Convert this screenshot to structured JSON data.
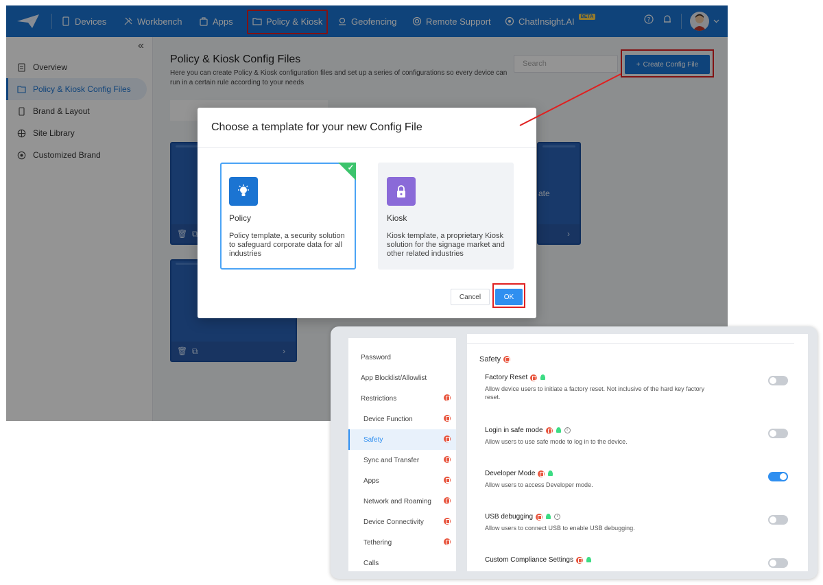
{
  "nav": {
    "items": [
      {
        "label": "Devices"
      },
      {
        "label": "Workbench"
      },
      {
        "label": "Apps"
      },
      {
        "label": "Policy & Kiosk"
      },
      {
        "label": "Geofencing"
      },
      {
        "label": "Remote Support"
      },
      {
        "label": "ChatInsight.AI"
      }
    ],
    "beta_badge": "BETA",
    "brand_color": "#1b74d2"
  },
  "sidebar": {
    "items": [
      {
        "label": "Overview"
      },
      {
        "label": "Policy & Kiosk Config Files"
      },
      {
        "label": "Brand & Layout"
      },
      {
        "label": "Site Library"
      },
      {
        "label": "Customized Brand"
      }
    ]
  },
  "main": {
    "title": "Policy & Kiosk Config Files",
    "description": "Here you can create Policy & Kiosk configuration files and set up a series of configurations so every device can run in a certain rule according to your needs",
    "search_placeholder": "Search",
    "create_button": "Create Config File",
    "card_partial_text": "ate"
  },
  "modal": {
    "title": "Choose a template for your new Config File",
    "templates": [
      {
        "name": "Policy",
        "description": "Policy template, a security solution to safeguard corporate data for all industries",
        "selected": true,
        "icon": "lightbulb-icon",
        "color": "#1b74d2"
      },
      {
        "name": "Kiosk",
        "description": "Kiosk template, a proprietary Kiosk solution for the signage market and other related industries",
        "selected": false,
        "icon": "lock-icon",
        "color": "#8a6ad8"
      }
    ],
    "cancel_label": "Cancel",
    "ok_label": "OK"
  },
  "inset": {
    "menu": [
      {
        "label": "Password",
        "child": false,
        "badge": false
      },
      {
        "label": "App Blocklist/Allowlist",
        "child": false,
        "badge": false
      },
      {
        "label": "Restrictions",
        "child": false,
        "badge": true
      },
      {
        "label": "Device Function",
        "child": true,
        "badge": true
      },
      {
        "label": "Safety",
        "child": true,
        "badge": true,
        "active": true
      },
      {
        "label": "Sync and Transfer",
        "child": true,
        "badge": true
      },
      {
        "label": "Apps",
        "child": true,
        "badge": true
      },
      {
        "label": "Network and Roaming",
        "child": true,
        "badge": true
      },
      {
        "label": "Device Connectivity",
        "child": true,
        "badge": true
      },
      {
        "label": "Tethering",
        "child": true,
        "badge": true
      },
      {
        "label": "Calls",
        "child": true,
        "badge": false
      }
    ],
    "section_title": "Safety",
    "settings": [
      {
        "name": "Factory Reset",
        "description": "Allow device users to initiate a factory reset. Not inclusive of the hard key factory reset.",
        "enabled": false,
        "info": false
      },
      {
        "name": "Login in safe mode",
        "description": "Allow users to use safe mode to log in to the device.",
        "enabled": false,
        "info": true
      },
      {
        "name": "Developer Mode",
        "description": "Allow users to access Developer mode.",
        "enabled": true,
        "info": false
      },
      {
        "name": "USB debugging",
        "description": "Allow users to connect USB to enable USB debugging.",
        "enabled": false,
        "info": true
      },
      {
        "name": "Custom Compliance Settings",
        "description": "",
        "enabled": false,
        "info": false
      }
    ]
  },
  "colors": {
    "accent": "#2f8ff0",
    "annotation_red": "#e02020",
    "selected_check": "#3cc46c"
  }
}
